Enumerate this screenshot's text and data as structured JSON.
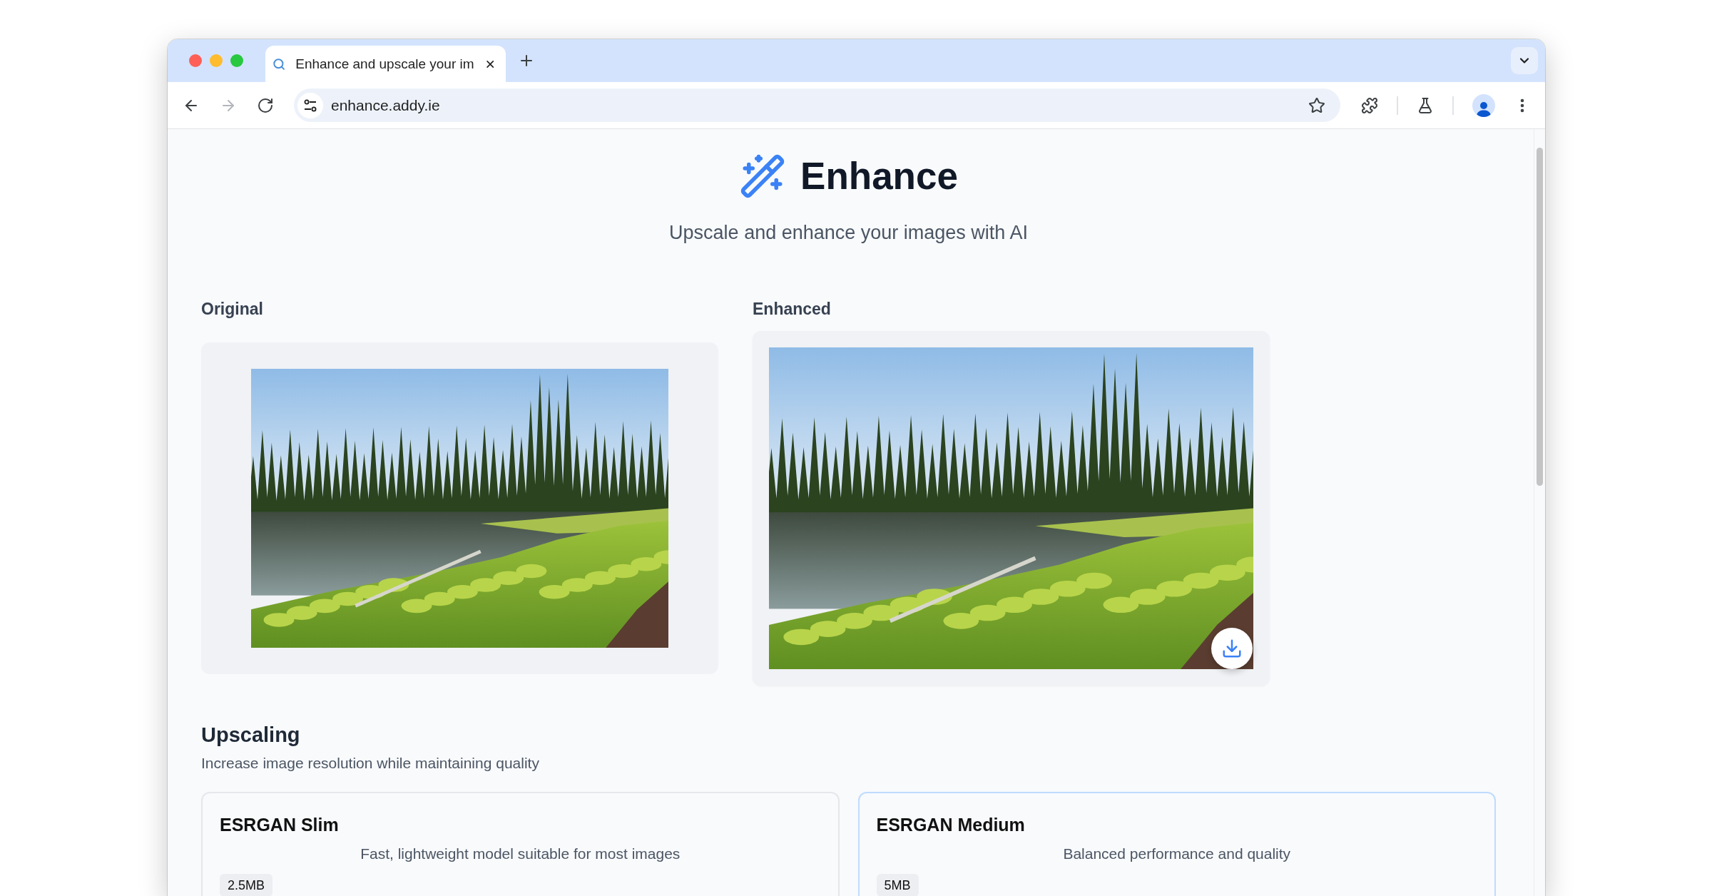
{
  "browser": {
    "tabs": [
      {
        "title": "Enhance and upscale your im",
        "selected": true
      }
    ],
    "nav_buttons": [
      {
        "kind": "back",
        "disabled": false
      },
      {
        "kind": "forward",
        "disabled": true
      },
      {
        "kind": "reload",
        "disabled": false
      }
    ],
    "url": "enhance.addy.ie"
  },
  "header": {
    "title": "Enhance",
    "subtitle": "Upscale and enhance your images with AI"
  },
  "comparison": [
    {
      "label": "Original",
      "kind": "original"
    },
    {
      "label": "Enhanced",
      "kind": "enhanced"
    }
  ],
  "upscaling": {
    "title": "Upscaling",
    "description": "Increase image resolution while maintaining quality",
    "models": [
      {
        "name": "ESRGAN Slim",
        "description": "Fast, lightweight model suitable for most images",
        "size": "2.5MB",
        "selected": false
      },
      {
        "name": "ESRGAN Medium",
        "description": "Balanced performance and quality",
        "size": "5MB",
        "selected": true
      }
    ]
  }
}
